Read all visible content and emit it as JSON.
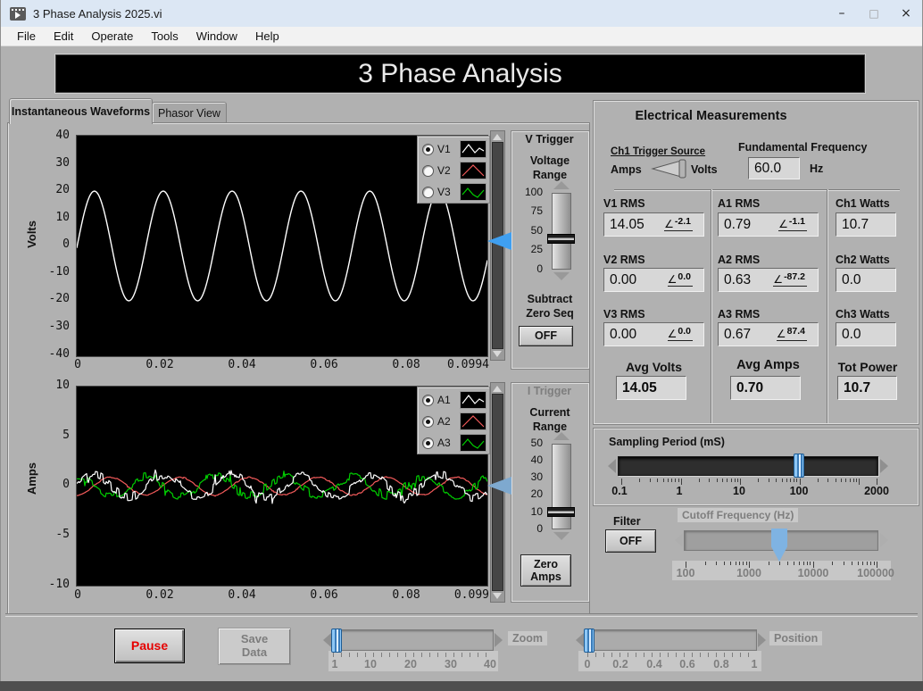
{
  "window": {
    "title": "3 Phase Analysis 2025.vi",
    "minimize": "–",
    "maximize": "□",
    "close": "×"
  },
  "menu": {
    "items": [
      "File",
      "Edit",
      "Operate",
      "Tools",
      "Window",
      "Help"
    ]
  },
  "banner": {
    "title": "3 Phase Analysis"
  },
  "tabs": [
    {
      "label": "Instantaneous Waveforms",
      "active": true
    },
    {
      "label": "Phasor View",
      "active": false
    }
  ],
  "volt_graph": {
    "y_label": "Volts",
    "y_ticks": [
      "40",
      "30",
      "20",
      "10",
      "0",
      "-10",
      "-20",
      "-30",
      "-40"
    ],
    "x_ticks": [
      "0",
      "0.02",
      "0.04",
      "0.06",
      "0.08",
      "0.0994"
    ],
    "legend": [
      {
        "label": "V1",
        "selected": true
      },
      {
        "label": "V2",
        "selected": false
      },
      {
        "label": "V3",
        "selected": false
      }
    ]
  },
  "v_trigger": {
    "title": "V Trigger",
    "range_label": "Voltage Range",
    "scale": [
      "100",
      "75",
      "50",
      "25",
      "0"
    ],
    "value": "40",
    "subtract_label": "Subtract Zero Seq",
    "off_button": "OFF"
  },
  "amp_graph": {
    "y_label": "Amps",
    "y_ticks": [
      "10",
      "5",
      "0",
      "-5",
      "-10"
    ],
    "x_ticks": [
      "0",
      "0.02",
      "0.04",
      "0.06",
      "0.08",
      "0.099"
    ],
    "legend": [
      {
        "label": "A1",
        "selected": true
      },
      {
        "label": "A2",
        "selected": true
      },
      {
        "label": "A3",
        "selected": true
      }
    ]
  },
  "i_trigger": {
    "title": "I Trigger",
    "range_label": "Current Range",
    "scale": [
      "50",
      "40",
      "30",
      "20",
      "10",
      "0"
    ],
    "value": "10",
    "zero_button": "Zero Amps"
  },
  "measurements": {
    "title": "Electrical Measurements",
    "angle_symbol": "∠",
    "trigger_source": {
      "label": "Ch1 Trigger Source",
      "left": "Amps",
      "right": "Volts",
      "value": "Volts"
    },
    "fundamental": {
      "label": "Fundamental Frequency",
      "value": "60.0",
      "unit": "Hz"
    },
    "volts_col": {
      "rows": [
        {
          "label": "V1 RMS",
          "value": "14.05",
          "angle": "-2.1"
        },
        {
          "label": "V2 RMS",
          "value": "0.00",
          "angle": "0.0"
        },
        {
          "label": "V3 RMS",
          "value": "0.00",
          "angle": "0.0"
        }
      ],
      "avg_label": "Avg Volts",
      "avg_value": "14.05"
    },
    "amps_col": {
      "rows": [
        {
          "label": "A1 RMS",
          "value": "0.79",
          "angle": "-1.1"
        },
        {
          "label": "A2 RMS",
          "value": "0.63",
          "angle": "-87.2"
        },
        {
          "label": "A3 RMS",
          "value": "0.67",
          "angle": "87.4"
        }
      ],
      "avg_label": "Avg Amps",
      "avg_value": "0.70"
    },
    "watts_col": {
      "rows": [
        {
          "label": "Ch1 Watts",
          "value": "10.7"
        },
        {
          "label": "Ch2 Watts",
          "value": "0.0"
        },
        {
          "label": "Ch3 Watts",
          "value": "0.0"
        }
      ],
      "avg_label": "Tot Power",
      "avg_value": "10.7"
    }
  },
  "sampling": {
    "label": "Sampling Period (mS)",
    "scale": [
      "0.1",
      "1",
      "10",
      "100",
      "2000"
    ],
    "value": "100"
  },
  "filter": {
    "label": "Filter",
    "off_button": "OFF",
    "cutoff_label": "Cutoff Frequency (Hz)",
    "scale": [
      "100",
      "1000",
      "10000",
      "100000"
    ],
    "value": "3000"
  },
  "footer": {
    "pause_button": "Pause",
    "save_button": "Save Data",
    "zoom": {
      "label": "Zoom",
      "scale": [
        "1",
        "10",
        "20",
        "30",
        "40"
      ],
      "value": "1"
    },
    "position": {
      "label": "Position",
      "scale": [
        "0",
        "0.2",
        "0.4",
        "0.6",
        "0.8",
        "1"
      ],
      "value": "0"
    }
  },
  "colors": {
    "accent_blue": "#3f9ff0",
    "pause_red": "#e60000",
    "v1": "#ffffff",
    "v2": "#f25a5a",
    "v3": "#00cf00"
  },
  "chart_data": [
    {
      "type": "line",
      "title": "Instantaneous voltage waveforms",
      "ylabel": "Volts",
      "x_range": [
        0,
        0.0994
      ],
      "y_range": [
        -40,
        40
      ],
      "x_ticks": [
        0,
        0.02,
        0.04,
        0.06,
        0.08,
        0.0994
      ],
      "y_ticks": [
        -40,
        -30,
        -20,
        -10,
        0,
        10,
        20,
        30,
        40
      ],
      "plot_bg": "#000000",
      "grid": false,
      "legend_position": "top-right",
      "series": [
        {
          "name": "V1",
          "color": "#ffffff",
          "visible": true,
          "waveform": "sine",
          "amplitude_peak": 19.9,
          "rms": 14.05,
          "frequency_hz": 60,
          "phase_deg": -2.1,
          "noise": 0
        },
        {
          "name": "V2",
          "color": "#f25a5a",
          "visible": false,
          "rms": 0.0
        },
        {
          "name": "V3",
          "color": "#00cf00",
          "visible": false,
          "rms": 0.0
        }
      ]
    },
    {
      "type": "line",
      "title": "Instantaneous current waveforms",
      "ylabel": "Amps",
      "x_range": [
        0,
        0.099
      ],
      "y_range": [
        -10,
        10
      ],
      "x_ticks": [
        0,
        0.02,
        0.04,
        0.06,
        0.08,
        0.099
      ],
      "y_ticks": [
        -10,
        -5,
        0,
        5,
        10
      ],
      "plot_bg": "#000000",
      "grid": false,
      "legend_position": "top-right",
      "series": [
        {
          "name": "A2",
          "color": "#f25a5a",
          "visible": true,
          "waveform": "sine",
          "amplitude_peak": 0.89,
          "rms": 0.63,
          "frequency_hz": 60,
          "phase_deg": -87.2,
          "noise": 0.06
        },
        {
          "name": "A3",
          "color": "#00cf00",
          "visible": true,
          "waveform": "sine",
          "amplitude_peak": 0.95,
          "rms": 0.67,
          "frequency_hz": 60,
          "phase_deg": 87.4,
          "noise": 0.42
        },
        {
          "name": "A1",
          "color": "#ffffff",
          "visible": true,
          "waveform": "sine",
          "amplitude_peak": 1.12,
          "rms": 0.79,
          "frequency_hz": 60,
          "phase_deg": -1.1,
          "noise": 0.45
        }
      ]
    }
  ]
}
